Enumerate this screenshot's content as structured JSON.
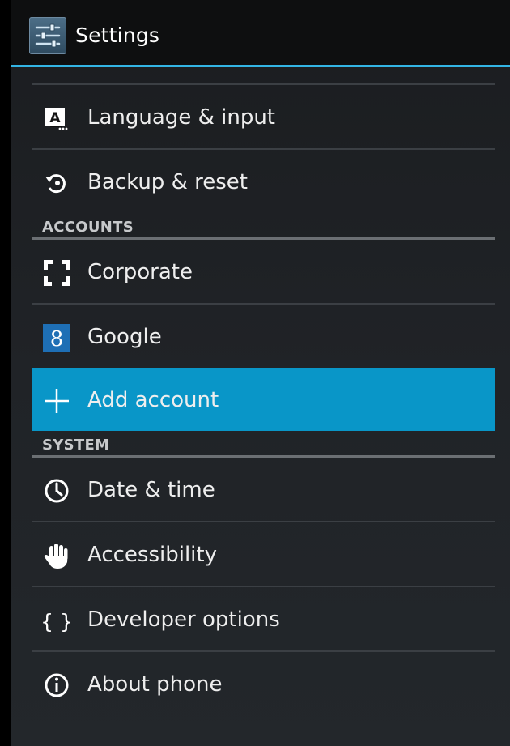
{
  "action_bar": {
    "title": "Settings",
    "icon": "settings-sliders-icon"
  },
  "items": {
    "language": {
      "label": "Language & input",
      "icon": "keyboard-a-icon"
    },
    "backup": {
      "label": "Backup & reset",
      "icon": "restore-icon"
    },
    "accounts_header": "ACCOUNTS",
    "corporate": {
      "label": "Corporate",
      "icon": "corporate-frame-icon"
    },
    "google": {
      "label": "Google",
      "icon": "google-g-icon",
      "icon_glyph": "8"
    },
    "add_account": {
      "label": "Add account",
      "icon": "plus-icon",
      "selected": true
    },
    "system_header": "SYSTEM",
    "date_time": {
      "label": "Date & time",
      "icon": "clock-icon"
    },
    "accessibility": {
      "label": "Accessibility",
      "icon": "hand-icon"
    },
    "developer": {
      "label": "Developer options",
      "icon": "braces-icon",
      "icon_glyph": "{ }"
    },
    "about": {
      "label": "About phone",
      "icon": "info-icon"
    }
  },
  "colors": {
    "accent": "#33b5e5",
    "selected_row": "#0996c8",
    "google_blue": "#1e6fb5",
    "background": "#202327"
  }
}
